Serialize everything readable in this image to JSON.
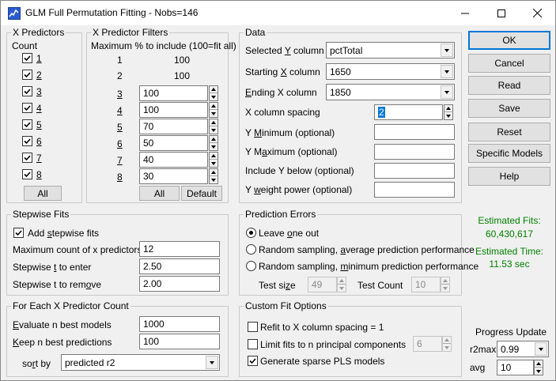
{
  "window": {
    "title": "GLM Full Permutation Fitting - Nobs=146",
    "icon": "chart-app-icon"
  },
  "x_predictors": {
    "title": "X Predictors",
    "count_label": "Count",
    "items": [
      {
        "label": "1",
        "checked": true
      },
      {
        "label": "2",
        "checked": true
      },
      {
        "label": "3",
        "checked": true
      },
      {
        "label": "4",
        "checked": true
      },
      {
        "label": "5",
        "checked": true
      },
      {
        "label": "6",
        "checked": true
      },
      {
        "label": "7",
        "checked": true
      },
      {
        "label": "8",
        "checked": true
      }
    ],
    "all_button": "All"
  },
  "filters": {
    "title": "X Predictor Filters",
    "subtitle": "Maximum % to include (100=fit all)",
    "static_rows": [
      {
        "label": "1",
        "value": "100"
      },
      {
        "label": "2",
        "value": "100"
      }
    ],
    "rows": [
      {
        "label": "3",
        "value": "100"
      },
      {
        "label": "4",
        "value": "100"
      },
      {
        "label": "5",
        "value": "70"
      },
      {
        "label": "6",
        "value": "50"
      },
      {
        "label": "7",
        "value": "40"
      },
      {
        "label": "8",
        "value": "30"
      }
    ],
    "all_button": "All",
    "default_button": "Default"
  },
  "data": {
    "title": "Data",
    "selected_y_label": "Selected Y column",
    "selected_y_value": "pctTotal",
    "starting_x_label": "Starting X column",
    "starting_x_value": "1650",
    "ending_x_label": "Ending X column",
    "ending_x_value": "1850",
    "x_spacing_label": "X column spacing",
    "x_spacing_value": "2",
    "y_min_label": "Y Minimum (optional)",
    "y_min_value": "",
    "y_max_label": "Y Maximum (optional)",
    "y_max_value": "",
    "include_y_below_label": "Include Y below (optional)",
    "include_y_below_value": "",
    "y_weight_label": "Y weight power (optional)",
    "y_weight_value": ""
  },
  "buttons": {
    "ok": "OK",
    "cancel": "Cancel",
    "read": "Read",
    "save": "Save",
    "reset": "Reset",
    "specific_models": "Specific Models",
    "help": "Help"
  },
  "estimates": {
    "fits_label": "Estimated Fits:",
    "fits_value": "60,430,617",
    "time_label": "Estimated Time:",
    "time_value": "11.53 sec"
  },
  "stepwise": {
    "title": "Stepwise Fits",
    "add_label": "Add stepwise fits",
    "add_checked": true,
    "max_count_label": "Maximum count of x predictors",
    "max_count_value": "12",
    "t_enter_label": "Stepwise t to enter",
    "t_enter_value": "2.50",
    "t_remove_label": "Stepwise t to remove",
    "t_remove_value": "2.00"
  },
  "prediction": {
    "title": "Prediction Errors",
    "options": [
      {
        "label": "Leave one out",
        "selected": true
      },
      {
        "label": "Random sampling, average prediction performance",
        "selected": false
      },
      {
        "label": "Random sampling, minimum prediction performance",
        "selected": false
      }
    ],
    "test_size_label": "Test size",
    "test_size_value": "49",
    "test_count_label": "Test Count",
    "test_count_value": "10"
  },
  "each_count": {
    "title": "For Each X Predictor Count",
    "evaluate_label": "Evaluate n best models",
    "evaluate_value": "1000",
    "keep_label": "Keep n best predictions",
    "keep_value": "100",
    "sort_label": "sort by",
    "sort_value": "predicted r2"
  },
  "custom": {
    "title": "Custom Fit Options",
    "refit_label": "Refit to X column spacing = 1",
    "refit_checked": false,
    "limit_label": "Limit fits to n principal components",
    "limit_checked": false,
    "limit_value": "6",
    "sparse_label": "Generate sparse PLS models",
    "sparse_checked": true
  },
  "progress": {
    "title": "Progress Update",
    "r2max_label": "r2max",
    "r2max_value": "0.99",
    "avg_label": "avg",
    "avg_value": "10"
  }
}
